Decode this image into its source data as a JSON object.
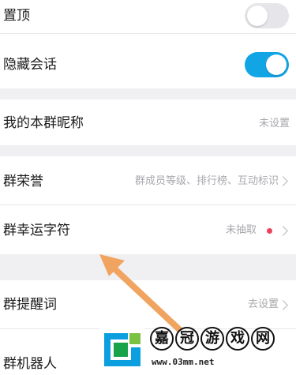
{
  "settings": {
    "pin_top": {
      "label": "置顶",
      "toggle": "off"
    },
    "hide_chat": {
      "label": "隐藏会话",
      "toggle": "on"
    },
    "nickname": {
      "label": "我的本群昵称",
      "value": "未设置"
    },
    "honor": {
      "label": "群荣誉",
      "value": "群成员等级、排行榜、互动标识"
    },
    "lucky_char": {
      "label": "群幸运字符",
      "value": "未抽取"
    },
    "reminder": {
      "label": "群提醒词",
      "value": "去设置"
    },
    "robot": {
      "label": "群机器人"
    }
  },
  "colors": {
    "toggle_on": "#12a5e6",
    "toggle_off": "#e6e6ea",
    "arrow": "#f0a460",
    "red_dot": "#f0405a"
  },
  "watermark": {
    "chars": [
      "嘉",
      "冠",
      "游",
      "戏",
      "网"
    ],
    "url": "www.03mm.net"
  }
}
